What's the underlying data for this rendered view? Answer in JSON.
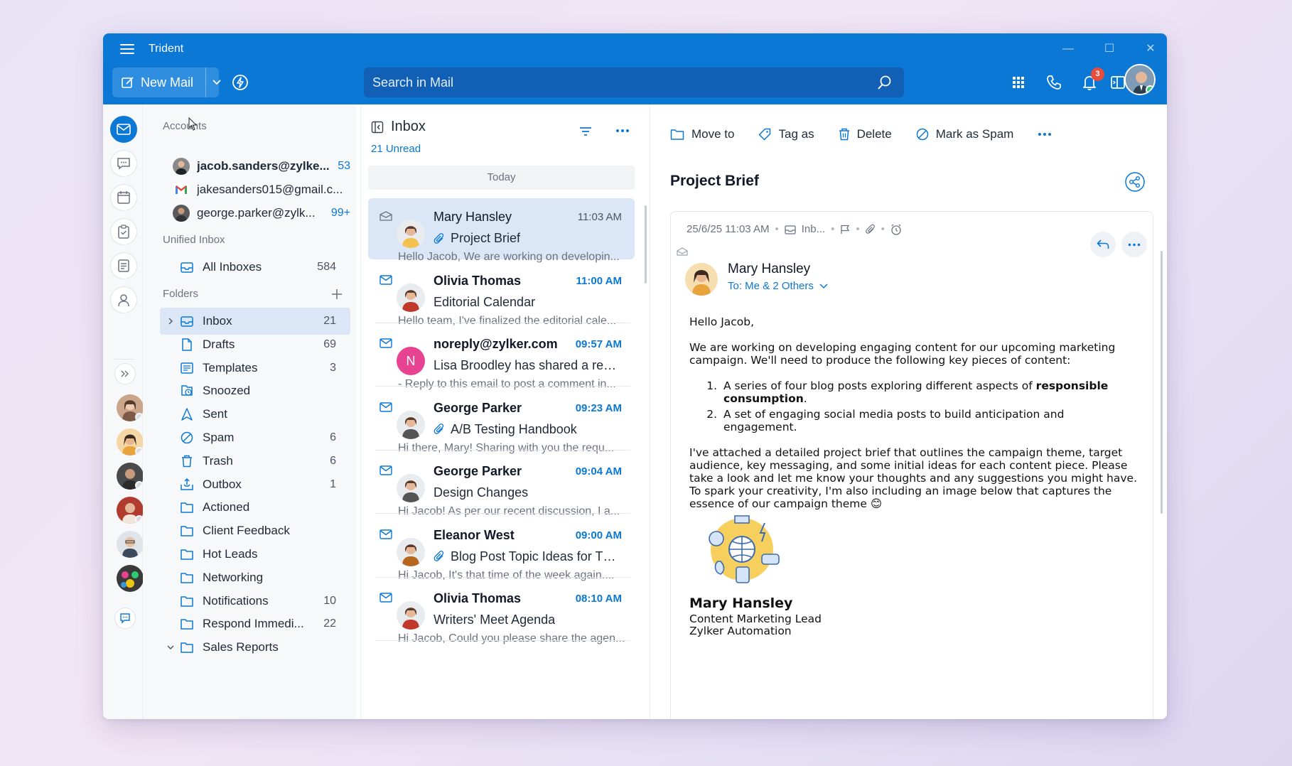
{
  "app": {
    "title": "Trident"
  },
  "toolbar": {
    "new_mail": "New Mail",
    "search_placeholder": "Search in Mail",
    "notification_count": "3"
  },
  "accounts": {
    "heading": "Accounts",
    "items": [
      {
        "name": "jacob.sanders@zylke...",
        "count": "53",
        "icon": "avatar-photo"
      },
      {
        "name": "jakesanders015@gmail.c...",
        "count": "",
        "icon": "gmail-icon"
      },
      {
        "name": "george.parker@zylk...",
        "count": "99+",
        "icon": "avatar-photo"
      }
    ]
  },
  "unified": {
    "heading": "Unified Inbox",
    "all_inboxes": "All Inboxes",
    "all_count": "584"
  },
  "folders": {
    "heading": "Folders",
    "items": [
      {
        "label": "Inbox",
        "count": "21",
        "icon": "inbox-icon"
      },
      {
        "label": "Drafts",
        "count": "69",
        "icon": "drafts-icon"
      },
      {
        "label": "Templates",
        "count": "3",
        "icon": "templates-icon"
      },
      {
        "label": "Snoozed",
        "count": "",
        "icon": "snoozed-icon"
      },
      {
        "label": "Sent",
        "count": "",
        "icon": "sent-icon"
      },
      {
        "label": "Spam",
        "count": "6",
        "icon": "spam-icon"
      },
      {
        "label": "Trash",
        "count": "6",
        "icon": "trash-icon"
      },
      {
        "label": "Outbox",
        "count": "1",
        "icon": "outbox-icon"
      },
      {
        "label": "Actioned",
        "count": "",
        "icon": "folder-icon"
      },
      {
        "label": "Client Feedback",
        "count": "",
        "icon": "folder-icon"
      },
      {
        "label": "Hot Leads",
        "count": "",
        "icon": "folder-icon"
      },
      {
        "label": "Networking",
        "count": "",
        "icon": "folder-icon"
      },
      {
        "label": "Notifications",
        "count": "10",
        "icon": "folder-icon"
      },
      {
        "label": "Respond Immedi...",
        "count": "22",
        "icon": "folder-icon"
      },
      {
        "label": "Sales Reports",
        "count": "",
        "icon": "folder-icon"
      }
    ]
  },
  "list": {
    "title": "Inbox",
    "unread": "21 Unread",
    "group": "Today",
    "mails": [
      {
        "from": "Mary Hansley",
        "time": "11:03 AM",
        "subject": "Project Brief",
        "attachment": true,
        "preview": "Hello Jacob, We are working on developin...",
        "avatar": "#f2c14e"
      },
      {
        "from": "Olivia Thomas",
        "time": "11:00 AM",
        "subject": "Editorial Calendar",
        "attachment": false,
        "preview": "Hello team, I've finalized the editorial cale...",
        "avatar": "#c0392b"
      },
      {
        "from": "noreply@zylker.com",
        "time": "09:57 AM",
        "subject": "Lisa Broodley has shared a reco...",
        "attachment": false,
        "preview": "- Reply to this email to post a comment in...",
        "avatar": "#e84393",
        "initial": "N"
      },
      {
        "from": "George Parker",
        "time": "09:23 AM",
        "subject": "A/B Testing Handbook",
        "attachment": true,
        "preview": "Hi there, Mary! Sharing with you the requ...",
        "avatar": "#555"
      },
      {
        "from": "George Parker",
        "time": "09:04 AM",
        "subject": "Design Changes",
        "attachment": false,
        "preview": "Hi Jacob! As per our recent discussion, I a...",
        "avatar": "#555"
      },
      {
        "from": "Eleanor West",
        "time": "09:00 AM",
        "subject": "Blog Post Topic Ideas for Thi...",
        "attachment": true,
        "preview": "Hi Jacob, It's that time of the week again....",
        "avatar": "#b5651d"
      },
      {
        "from": "Olivia Thomas",
        "time": "08:10 AM",
        "subject": "Writers' Meet Agenda",
        "attachment": false,
        "preview": "Hi Jacob, Could you please share the agen...",
        "avatar": "#c0392b"
      }
    ]
  },
  "reader": {
    "actions": {
      "move": "Move to",
      "tag": "Tag as",
      "delete": "Delete",
      "spam": "Mark as Spam"
    },
    "subject": "Project Brief",
    "meta_date": "25/6/25 11:03 AM",
    "meta_folder": "Inb...",
    "sender": "Mary Hansley",
    "to": "To: Me & 2 Others",
    "greeting": "Hello Jacob,",
    "para1": "We are working on developing engaging content for our upcoming marketing campaign. We'll need to produce the following key pieces of content:",
    "item1_a": "A series of four blog posts exploring different aspects of ",
    "item1_b": "responsible consumption",
    "item1_c": ".",
    "item2": "A set of engaging social media posts to build anticipation and engagement.",
    "para2": "I've attached a detailed project brief that outlines the campaign theme, target audience, key messaging, and some initial ideas for each content piece. Please take a look and let me know your thoughts and any suggestions you might have. To spark your creativity, I'm also including an image below that captures the essence of our campaign theme 😊",
    "sig_name": "Mary Hansley",
    "sig_title": "Content Marketing Lead",
    "sig_company": "Zylker Automation"
  },
  "colors": {
    "brand": "#0a78d4",
    "selected": "#dbe7f6"
  }
}
